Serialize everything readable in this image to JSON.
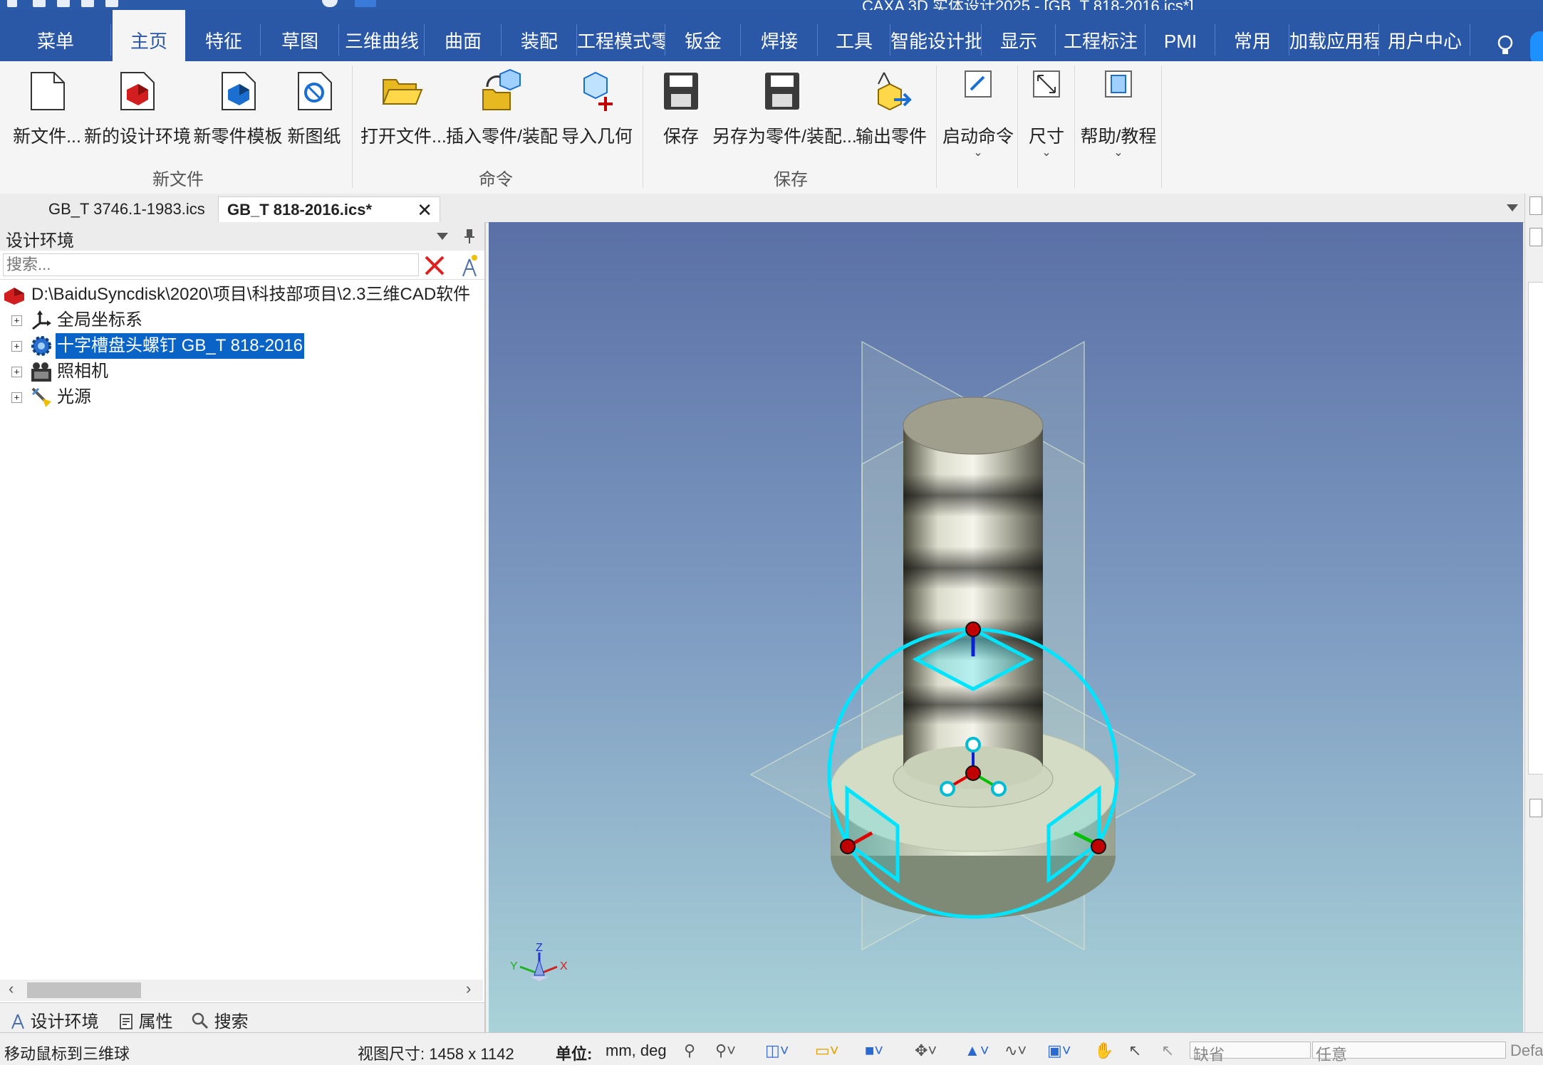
{
  "window": {
    "title": "CAXA 3D 实体设计2025 - [GB_T 818-2016.ics*]"
  },
  "ribbon_tabs": [
    {
      "label": "菜单",
      "active": false
    },
    {
      "label": "主页",
      "active": true
    },
    {
      "label": "特征",
      "active": false
    },
    {
      "label": "草图",
      "active": false
    },
    {
      "label": "三维曲线",
      "active": false
    },
    {
      "label": "曲面",
      "active": false
    },
    {
      "label": "装配",
      "active": false
    },
    {
      "label": "工程模式零",
      "active": false
    },
    {
      "label": "钣金",
      "active": false
    },
    {
      "label": "焊接",
      "active": false
    },
    {
      "label": "工具",
      "active": false
    },
    {
      "label": "智能设计批",
      "active": false
    },
    {
      "label": "显示",
      "active": false
    },
    {
      "label": "工程标注",
      "active": false
    },
    {
      "label": "PMI",
      "active": false
    },
    {
      "label": "常用",
      "active": false
    },
    {
      "label": "加载应用程",
      "active": false
    },
    {
      "label": "用户中心",
      "active": false
    }
  ],
  "ribbon": {
    "groups": [
      {
        "label": "新文件",
        "buttons": [
          "新文件...",
          "新的设计环境",
          "新零件模板",
          "新图纸"
        ]
      },
      {
        "label": "命令",
        "buttons": [
          "打开文件...",
          "插入零件/装配",
          "导入几何"
        ]
      },
      {
        "label": "保存",
        "buttons": [
          "保存",
          "另存为零件/装配...",
          "输出零件"
        ]
      },
      {
        "label": "",
        "buttons": [
          "启动命令",
          "尺寸",
          "帮助/教程"
        ]
      }
    ]
  },
  "doc_tabs": [
    {
      "label": "GB_T 3746.1-1983.ics",
      "active": false
    },
    {
      "label": "GB_T 818-2016.ics*",
      "active": true
    }
  ],
  "left_panel": {
    "title": "设计环境",
    "search_placeholder": "搜索...",
    "tree": {
      "root": "D:\\BaiduSyncdisk\\2020\\项目\\科技部项目\\2.3三维CAD软件",
      "items": [
        {
          "label": "全局坐标系",
          "icon": "coordinate-system-icon",
          "selected": false
        },
        {
          "label": "十字槽盘头螺钉 GB_T 818-2016",
          "icon": "part-gear-icon",
          "selected": true
        },
        {
          "label": "照相机",
          "icon": "camera-icon",
          "selected": false
        },
        {
          "label": "光源",
          "icon": "light-icon",
          "selected": false
        }
      ]
    },
    "bottom_tabs": [
      "设计环境",
      "属性",
      "搜索"
    ]
  },
  "viewport": {
    "axis_labels": {
      "x": "X",
      "y": "Y",
      "z": "Z"
    }
  },
  "statusbar": {
    "message": "移动鼠标到三维球",
    "view_size": "视图尺寸: 1458 x 1142",
    "units_label": "单位:",
    "units_value": "mm, deg",
    "combo1": "缺省",
    "combo2": "任意",
    "combo3": "Defa"
  },
  "colors": {
    "ribbon_blue": "#2b58a6",
    "selection_blue": "#0a64c8",
    "triball_cyan": "#00e5ff",
    "handle_red": "#c00000"
  }
}
